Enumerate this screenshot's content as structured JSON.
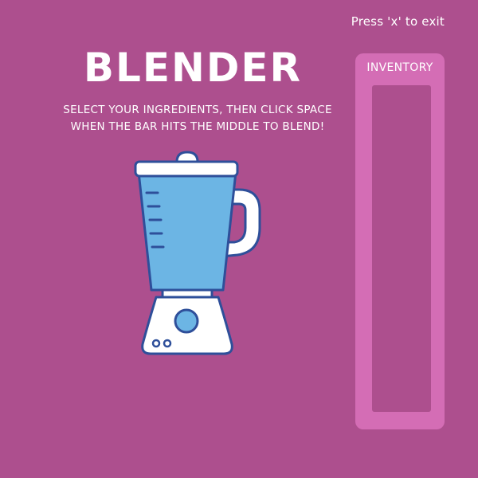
{
  "exit_hint": "Press 'x' to exit",
  "title": "BLENDER",
  "instructions": {
    "line1": "SELECT YOUR INGREDIENTS, THEN CLICK SPACE",
    "line2": "WHEN THE BAR HITS THE MIDDLE TO BLEND!"
  },
  "inventory": {
    "label": "INVENTORY",
    "items": []
  },
  "colors": {
    "background": "#ad4f8e",
    "panel": "#d46db5",
    "jar": "#6cb5e4",
    "outline": "#2e4f9a"
  },
  "icons": {
    "blender": "blender-icon"
  }
}
